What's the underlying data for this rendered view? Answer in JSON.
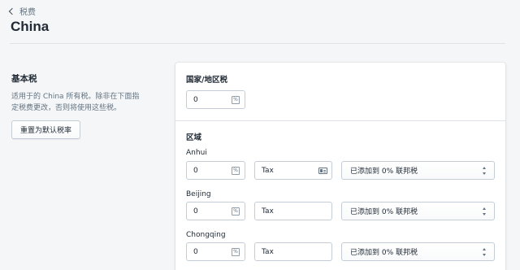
{
  "breadcrumb": {
    "label": "税费"
  },
  "page": {
    "title": "China"
  },
  "base_tax": {
    "title": "基本税",
    "description_line1": "适用于的 China 所有税。除非在下面指",
    "description_line2": "定税费更改，否则将使用这些税。",
    "reset_button": "重置为默认税率"
  },
  "country_tax": {
    "label": "国家/地区税",
    "value": "0"
  },
  "regions": {
    "label": "区域",
    "items": [
      {
        "name": "Anhui",
        "rate": "0",
        "tax_name": "Tax",
        "mode": "已添加到 0% 联邦税"
      },
      {
        "name": "Beijing",
        "rate": "0",
        "tax_name": "Tax",
        "mode": "已添加到 0% 联邦税"
      },
      {
        "name": "Chongqing",
        "rate": "0",
        "tax_name": "Tax",
        "mode": "已添加到 0% 联邦税"
      }
    ]
  },
  "icons": {
    "back": "chevron-left-icon",
    "percent": "percent-icon",
    "contact_card": "contact-card-icon",
    "select_arrows": "select-arrows-icon"
  },
  "colors": {
    "background": "#f4f6f8",
    "card": "#ffffff",
    "border": "#c4cdd5",
    "text": "#212b36",
    "subdued": "#637381"
  }
}
